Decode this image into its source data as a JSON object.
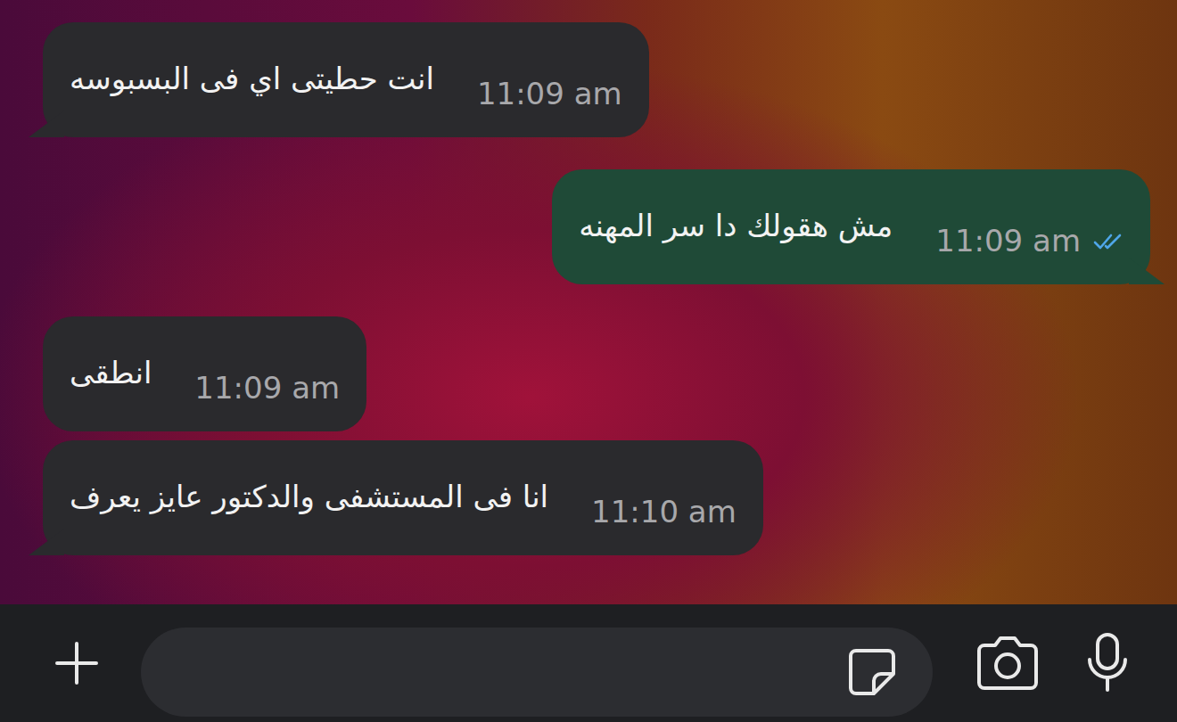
{
  "chat": {
    "messages": [
      {
        "text": "انت حطيتى اي فى البسبوسه",
        "time": "11:09 am",
        "direction": "incoming"
      },
      {
        "text": "مش هقولك دا سر المهنه",
        "time": "11:09 am",
        "direction": "outgoing",
        "read": true
      },
      {
        "text": "انطقى",
        "time": "11:09 am",
        "direction": "incoming"
      },
      {
        "text": "انا فى المستشفى والدكتور عايز يعرف",
        "time": "11:10 am",
        "direction": "incoming"
      }
    ]
  },
  "input": {
    "text": ""
  }
}
